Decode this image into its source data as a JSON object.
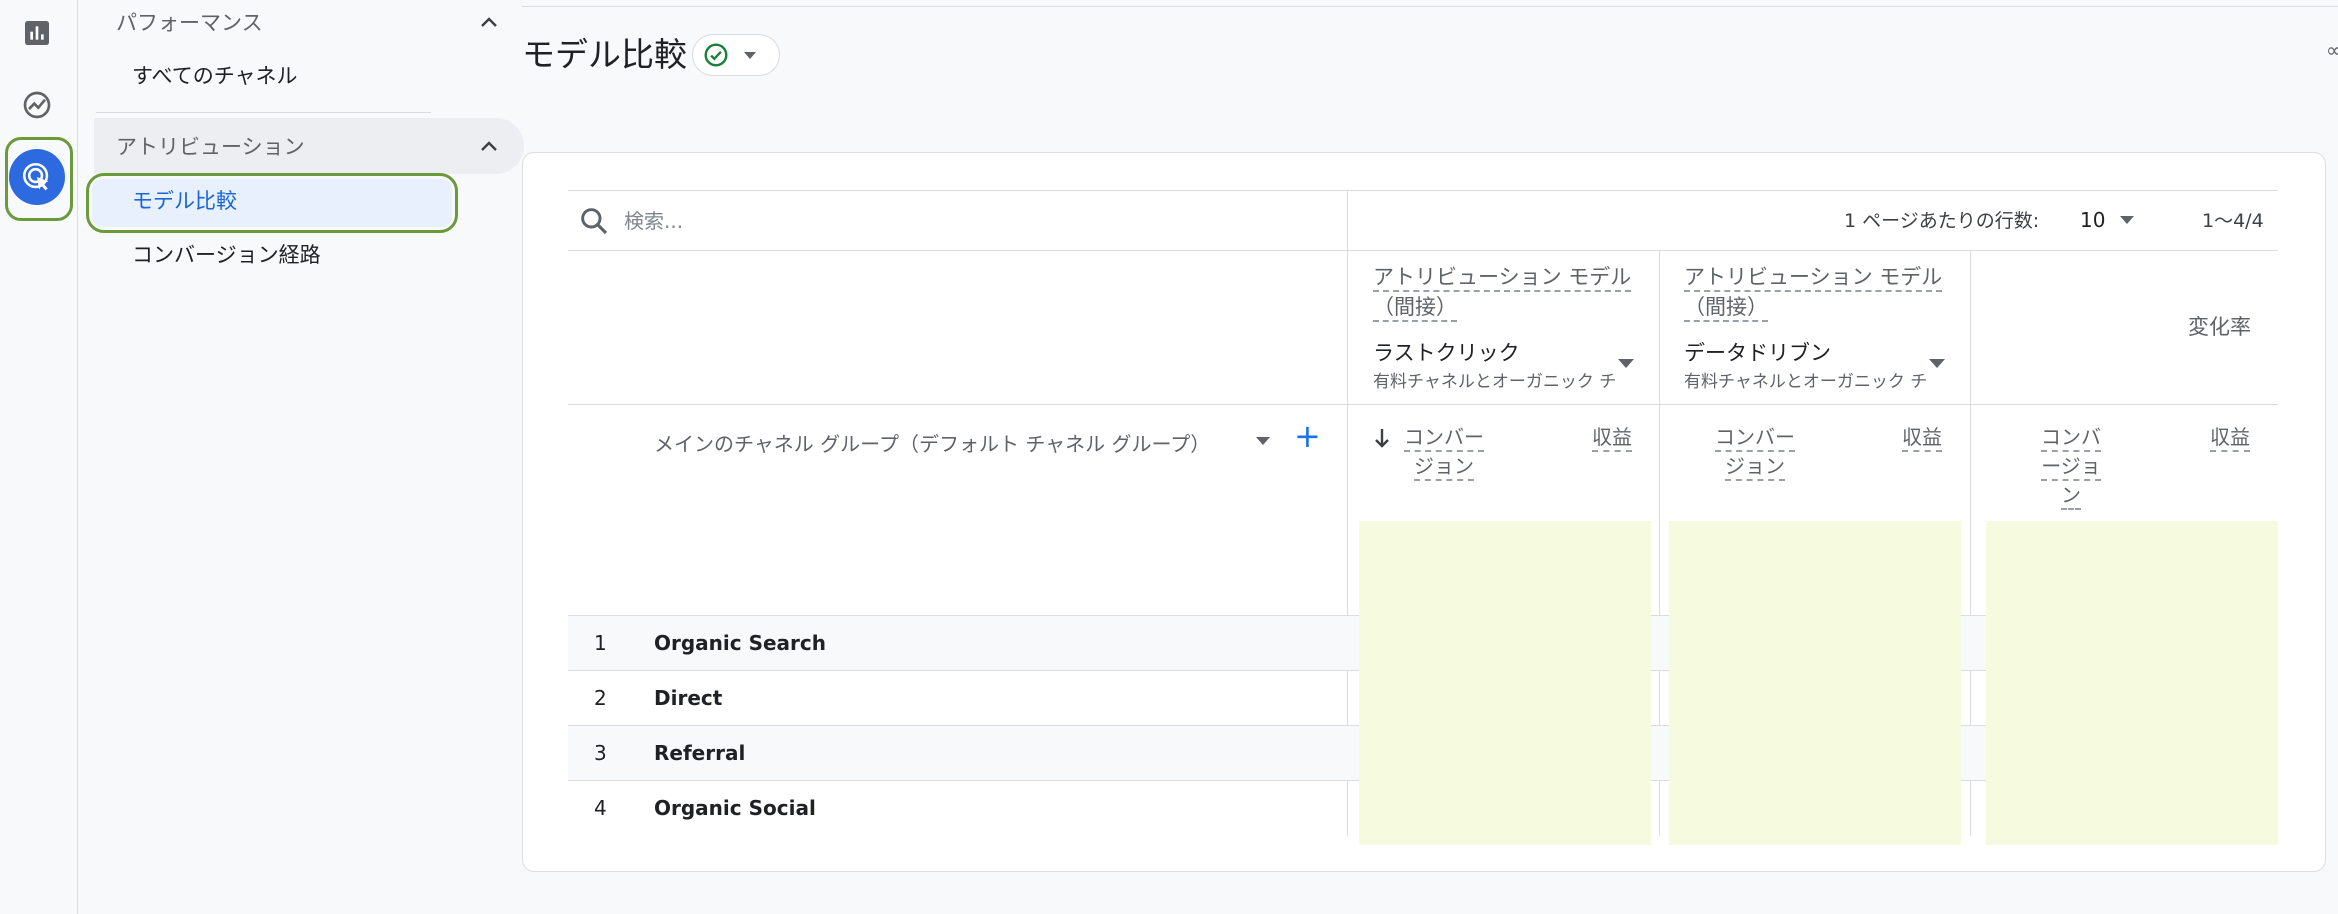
{
  "rail": {
    "items": [
      {
        "icon": "bar-chart-icon"
      },
      {
        "icon": "trend-icon"
      },
      {
        "icon": "attribution-icon",
        "active": true
      }
    ]
  },
  "sidenav": {
    "performance_section": "パフォーマンス",
    "all_channels": "すべてのチャネル",
    "attribution_section": "アトリビューション",
    "model_comparison": "モデル比較",
    "conversion_paths": "コンバージョン経路"
  },
  "header": {
    "title": "モデル比較",
    "status_icon": "check-circle-icon",
    "status_color": "#188038"
  },
  "toolbar": {
    "search_placeholder": "検索...",
    "rows_per_page_label": "1 ページあたりの行数:",
    "rows_per_page_value": "10",
    "page_range": "1〜4/4"
  },
  "models": [
    {
      "heading_line1": "アトリビューション モデル",
      "heading_line2": "（間接）",
      "name": "ラストクリック",
      "sub": "有料チャネルとオーガニック チ"
    },
    {
      "heading_line1": "アトリビューション モデル",
      "heading_line2": "（間接）",
      "name": "データドリブン",
      "sub": "有料チャネルとオーガニック チ"
    }
  ],
  "change_rate_label": "変化率",
  "dimension_label": "メインのチャネル グループ（デフォルト チャネル グループ）",
  "metrics": {
    "conversions_a_l1": "コンバー",
    "conversions_a_l2": "ジョン",
    "revenue": "収益",
    "conversions_c_l1": "コンバ",
    "conversions_c_l2": "ージョ",
    "conversions_c_l3": "ン"
  },
  "rows": [
    {
      "num": "1",
      "label": "Organic Search"
    },
    {
      "num": "2",
      "label": "Direct"
    },
    {
      "num": "3",
      "label": "Referral"
    },
    {
      "num": "4",
      "label": "Organic Social"
    }
  ],
  "colors": {
    "accent": "#1a73e8",
    "highlight_ring": "#6a9a3a",
    "bar_fill": "#f6fadf"
  }
}
